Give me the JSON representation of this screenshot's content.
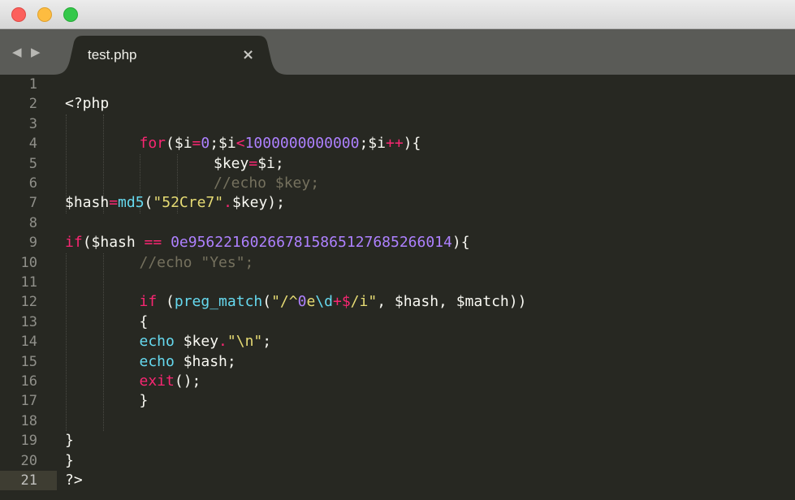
{
  "window": {
    "controls": [
      "close",
      "minimize",
      "maximize"
    ]
  },
  "tabbar": {
    "nav_back": "◀",
    "nav_forward": "▶",
    "active_tab": {
      "label": "test.php",
      "close_glyph": "×"
    }
  },
  "editor": {
    "language": "php",
    "active_line": 21,
    "colors": {
      "background": "#272822",
      "keyword": "#f92672",
      "number": "#ae81ff",
      "string": "#e6db74",
      "function": "#66d9ef",
      "comment": "#75715e",
      "text": "#f8f8f2"
    },
    "lines": [
      {
        "n": "1",
        "tokens": []
      },
      {
        "n": "2",
        "tokens": [
          {
            "t": "pl",
            "v": "<?php"
          }
        ]
      },
      {
        "n": "3",
        "tokens": []
      },
      {
        "n": "4",
        "indent": 1,
        "tokens": [
          {
            "t": "kw",
            "v": "for"
          },
          {
            "t": "pl",
            "v": "($i"
          },
          {
            "t": "op",
            "v": "="
          },
          {
            "t": "num",
            "v": "0"
          },
          {
            "t": "pl",
            "v": ";$i"
          },
          {
            "t": "op",
            "v": "<"
          },
          {
            "t": "num",
            "v": "1000000000000"
          },
          {
            "t": "pl",
            "v": ";$i"
          },
          {
            "t": "op",
            "v": "++"
          },
          {
            "t": "pl",
            "v": "){"
          }
        ]
      },
      {
        "n": "5",
        "indent": 2,
        "tokens": [
          {
            "t": "pl",
            "v": "$key"
          },
          {
            "t": "op",
            "v": "="
          },
          {
            "t": "pl",
            "v": "$i;"
          }
        ]
      },
      {
        "n": "6",
        "indent": 2,
        "tokens": [
          {
            "t": "cm",
            "v": "//echo $key;"
          }
        ]
      },
      {
        "n": "7",
        "tokens": [
          {
            "t": "pl",
            "v": "$hash"
          },
          {
            "t": "op",
            "v": "="
          },
          {
            "t": "fn",
            "v": "md5"
          },
          {
            "t": "pl",
            "v": "("
          },
          {
            "t": "str",
            "v": "\"52Cre7\""
          },
          {
            "t": "op",
            "v": "."
          },
          {
            "t": "pl",
            "v": "$key);"
          }
        ]
      },
      {
        "n": "8",
        "tokens": []
      },
      {
        "n": "9",
        "tokens": [
          {
            "t": "kw",
            "v": "if"
          },
          {
            "t": "pl",
            "v": "($hash "
          },
          {
            "t": "op",
            "v": "=="
          },
          {
            "t": "pl",
            "v": " "
          },
          {
            "t": "num",
            "v": "0e956221602667815865127685266014"
          },
          {
            "t": "pl",
            "v": "){"
          }
        ]
      },
      {
        "n": "10",
        "indent": 1,
        "tokens": [
          {
            "t": "cm",
            "v": "//echo \"Yes\";"
          }
        ]
      },
      {
        "n": "11",
        "tokens": []
      },
      {
        "n": "12",
        "indent": 1,
        "tokens": [
          {
            "t": "kw",
            "v": "if"
          },
          {
            "t": "pl",
            "v": " ("
          },
          {
            "t": "fn",
            "v": "preg_match"
          },
          {
            "t": "pl",
            "v": "("
          },
          {
            "t": "str",
            "v": "\"/^"
          },
          {
            "t": "num",
            "v": "0"
          },
          {
            "t": "str",
            "v": "e"
          },
          {
            "t": "fn",
            "v": "\\d"
          },
          {
            "t": "op",
            "v": "+$"
          },
          {
            "t": "str",
            "v": "/i\""
          },
          {
            "t": "pl",
            "v": ", $hash, $match))"
          }
        ]
      },
      {
        "n": "13",
        "indent": 1,
        "tokens": [
          {
            "t": "pl",
            "v": "{"
          }
        ]
      },
      {
        "n": "14",
        "indent": 1,
        "tokens": [
          {
            "t": "fn",
            "v": "echo"
          },
          {
            "t": "pl",
            "v": " $key"
          },
          {
            "t": "op",
            "v": "."
          },
          {
            "t": "str",
            "v": "\"\\n\""
          },
          {
            "t": "pl",
            "v": ";"
          }
        ]
      },
      {
        "n": "15",
        "indent": 1,
        "tokens": [
          {
            "t": "fn",
            "v": "echo"
          },
          {
            "t": "pl",
            "v": " $hash;"
          }
        ]
      },
      {
        "n": "16",
        "indent": 1,
        "tokens": [
          {
            "t": "kw",
            "v": "exit"
          },
          {
            "t": "pl",
            "v": "();"
          }
        ]
      },
      {
        "n": "17",
        "indent": 1,
        "tokens": [
          {
            "t": "pl",
            "v": "}"
          }
        ]
      },
      {
        "n": "18",
        "tokens": []
      },
      {
        "n": "19",
        "tokens": [
          {
            "t": "pl",
            "v": "}"
          }
        ]
      },
      {
        "n": "20",
        "tokens": [
          {
            "t": "pl",
            "v": "}"
          }
        ]
      },
      {
        "n": "21",
        "tokens": [
          {
            "t": "pl",
            "v": "?>"
          }
        ]
      }
    ]
  }
}
